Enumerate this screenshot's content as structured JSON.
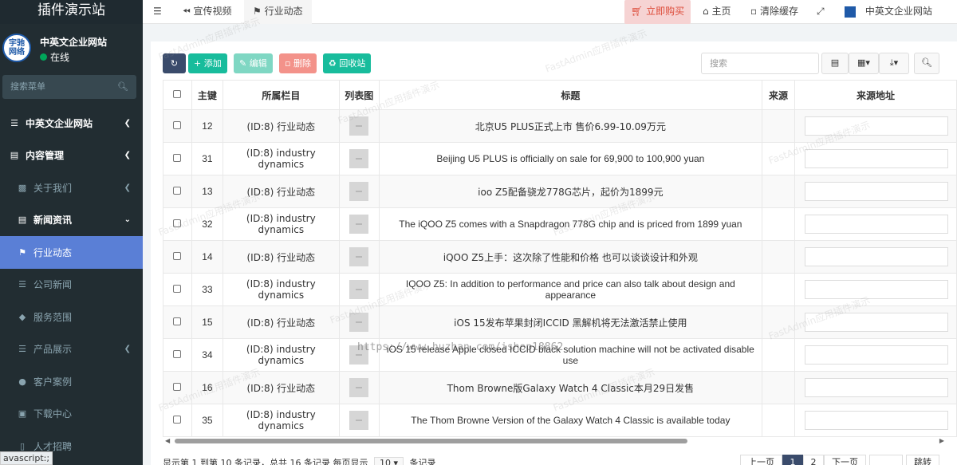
{
  "app": {
    "title": "插件演示站"
  },
  "user": {
    "name": "中英文企业网站",
    "status": "在线",
    "avatar_text": [
      "宇驰",
      "网络"
    ]
  },
  "sidebar": {
    "search_placeholder": "搜索菜单",
    "items": [
      {
        "label": "中英文企业网站"
      },
      {
        "label": "内容管理"
      },
      {
        "label": "关于我们"
      },
      {
        "label": "新闻资讯"
      },
      {
        "label": "行业动态"
      },
      {
        "label": "公司新闻"
      },
      {
        "label": "服务范围"
      },
      {
        "label": "产品展示"
      },
      {
        "label": "客户案例"
      },
      {
        "label": "下载中心"
      },
      {
        "label": "人才招聘"
      }
    ]
  },
  "status_tooltip": "avascript:;",
  "topbar": {
    "tabs": [
      {
        "label": "宣传视频"
      },
      {
        "label": "行业动态"
      }
    ],
    "buy": "立即购买",
    "home": "主页",
    "clear_cache": "清除缓存",
    "site_name": "中英文企业网站"
  },
  "toolbar": {
    "add": "添加",
    "edit": "编辑",
    "delete": "删除",
    "recycle": "回收站",
    "search_placeholder": "搜索"
  },
  "table": {
    "headers": [
      "主键",
      "所属栏目",
      "列表图",
      "标题",
      "来源",
      "来源地址"
    ],
    "rows": [
      {
        "id": "12",
        "category": "(ID:8) 行业动态",
        "title": "北京U5 PLUS正式上市 售价6.99-10.09万元"
      },
      {
        "id": "31",
        "category": "(ID:8) industry dynamics",
        "title": "Beijing U5 PLUS is officially on sale for 69,900 to 100,900 yuan"
      },
      {
        "id": "13",
        "category": "(ID:8) 行业动态",
        "title": "ioo Z5配备骁龙778G芯片，起价为1899元"
      },
      {
        "id": "32",
        "category": "(ID:8) industry dynamics",
        "title": "The iQOO Z5 comes with a Snapdragon 778G chip and is priced from 1899 yuan"
      },
      {
        "id": "14",
        "category": "(ID:8) 行业动态",
        "title": "iQOO Z5上手：这次除了性能和价格 也可以谈谈设计和外观"
      },
      {
        "id": "33",
        "category": "(ID:8) industry dynamics",
        "title": "IQOO Z5: In addition to performance and price can also talk about design and appearance"
      },
      {
        "id": "15",
        "category": "(ID:8) 行业动态",
        "title": "iOS 15发布苹果封闭ICCID 黑解机将无法激活禁止使用"
      },
      {
        "id": "34",
        "category": "(ID:8) industry dynamics",
        "title": "iOS 15 release Apple closed ICCID black solution machine will not be activated disable use"
      },
      {
        "id": "16",
        "category": "(ID:8) 行业动态",
        "title": "Thom Browne版Galaxy Watch 4 Classic本月29日发售"
      },
      {
        "id": "35",
        "category": "(ID:8) industry dynamics",
        "title": "The Thom Browne Version of the Galaxy Watch 4 Classic is available today"
      }
    ]
  },
  "footer": {
    "summary": "显示第 1 到第 10 条记录，总共 16 条记录 每页显示",
    "page_size": "10",
    "page_size_suffix": "条记录"
  },
  "pagination": {
    "prev": "上一页",
    "pages": [
      "1",
      "2"
    ],
    "next": "下一页",
    "jump": "跳转"
  },
  "watermarks": {
    "text": "FastAdmin应用插件演示",
    "url": "https://www.huzhan.com/ishop18862"
  },
  "colors": {
    "sidebar_bg": "#222d32",
    "active_menu": "#5a7fd6",
    "primary": "#18bc9c",
    "danger": "#dd4b39",
    "dark_btn": "#3a4b6b"
  }
}
